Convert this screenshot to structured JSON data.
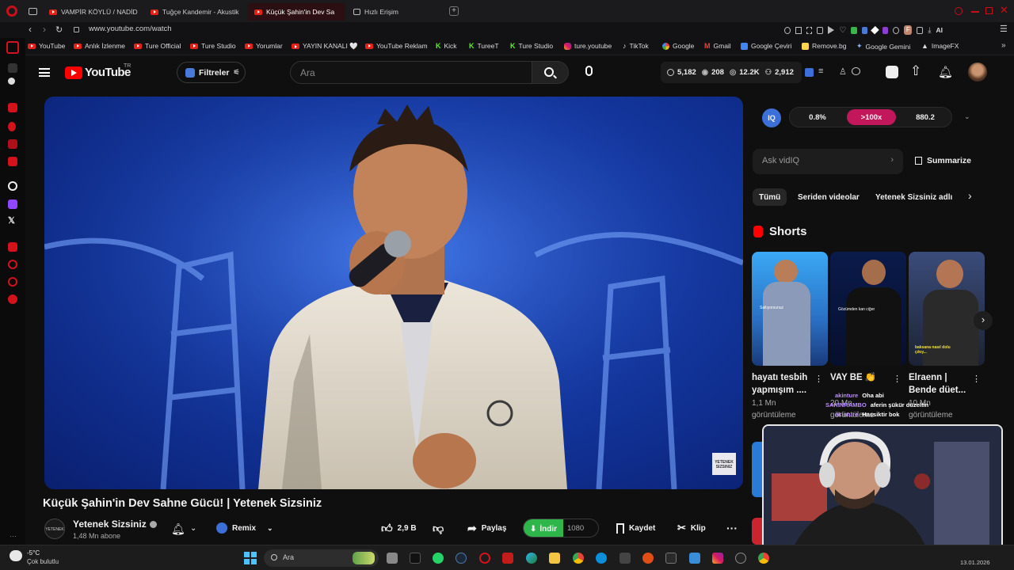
{
  "browser": {
    "tabs": [
      {
        "label": "VAMPİR KÖYLÜ / NADİDE"
      },
      {
        "label": "Tuğçe Kandemir - Akustik"
      },
      {
        "label": "Küçük Şahin'in Dev Sa"
      },
      {
        "label": "Hızlı Erişim"
      }
    ],
    "url": "www.youtube.com/watch",
    "profile_initial": "F",
    "ai_label": "AI",
    "bookmarks": [
      {
        "label": "YouTube",
        "icon": "youtube-icon"
      },
      {
        "label": "Anlık İzlenme",
        "icon": "youtube-icon"
      },
      {
        "label": "Ture Official",
        "icon": "youtube-icon"
      },
      {
        "label": "Ture Studio",
        "icon": "youtube-icon"
      },
      {
        "label": "Yorumlar",
        "icon": "youtube-icon"
      },
      {
        "label": "YAYIN KANALI 🤍",
        "icon": "youtube-icon"
      },
      {
        "label": "YouTube Reklam",
        "icon": "youtube-icon"
      },
      {
        "label": "Kick",
        "icon": "kick-icon"
      },
      {
        "label": "TureeT",
        "icon": "kick-icon"
      },
      {
        "label": "Ture Studio",
        "icon": "kick-icon"
      },
      {
        "label": "ture.youtube",
        "icon": "instagram-icon"
      },
      {
        "label": "TikTok",
        "icon": "tiktok-icon"
      },
      {
        "label": "Google",
        "icon": "google-icon"
      },
      {
        "label": "Gmail",
        "icon": "gmail-icon"
      },
      {
        "label": "Google Çeviri",
        "icon": "translate-icon"
      },
      {
        "label": "Remove.bg",
        "icon": "removebg-icon"
      },
      {
        "label": "Google Gemini",
        "icon": "gemini-icon"
      },
      {
        "label": "ImageFX",
        "icon": "imagefx-icon"
      }
    ]
  },
  "youtube": {
    "logo_text": "YouTube",
    "logo_region": "TR",
    "filter_label": "Filtreler",
    "search_placeholder": "Ara",
    "stats": {
      "a": "5,182",
      "b": "208",
      "c": "12.2K",
      "d": "2,912"
    },
    "video": {
      "title": "Küçük Şahin'in Dev Sahne Gücü! | Yetenek Sizsiniz",
      "watermark": "YETENEK SIZSINIZ"
    },
    "channel": {
      "name": "Yetenek Sizsiniz",
      "subscribers": "1,48 Mn abone",
      "avatar_text": "YETENEK SIZSINIZ"
    },
    "actions": {
      "remix": "Remix",
      "likes": "2,9 B",
      "share": "Paylaş",
      "download": "İndir",
      "quality": "1080",
      "save": "Kaydet",
      "clip": "Klip"
    }
  },
  "vidiq": {
    "logo": "IQ",
    "metric1": "0.8%",
    "metric2": ">100x",
    "metric3": "880.2",
    "ask_placeholder": "Ask vidIQ",
    "summarize": "Summarize"
  },
  "chips": [
    "Tümü",
    "Seriden videolar",
    "Yetenek Sizsiniz adlı"
  ],
  "shorts": {
    "heading": "Shorts",
    "items": [
      {
        "title": "hayatı tesbih yapmışım ....",
        "views": "1,1 Mn görüntüleme",
        "caption": "Sallıyorsunuz"
      },
      {
        "title": "VAY BE 👏",
        "views": "20 Mn görüntüleme",
        "caption": "Gözümden kan ciğer"
      },
      {
        "title": "Elraenn | Bende düet...",
        "views": "10 Mn görüntüleme",
        "caption": "baksana nasıl dolu çıkıy..."
      }
    ]
  },
  "chat": [
    {
      "user": "akinture",
      "msg": "Oha abi"
    },
    {
      "user": "SAKINRAMBO",
      "msg": "aferin şükür düzeltin"
    },
    {
      "user": "akinture",
      "msg": "Hassiktir bok"
    }
  ],
  "taskbar": {
    "weather_temp": "-5°C",
    "weather_desc": "Çok bulutlu",
    "search_label": "Ara",
    "date": "13.01.2026"
  },
  "colors": {
    "brand_red": "#ff0000",
    "download_green": "#2fb64a",
    "vidiq_pink": "#c2185b",
    "opera_red": "#d3121c"
  }
}
